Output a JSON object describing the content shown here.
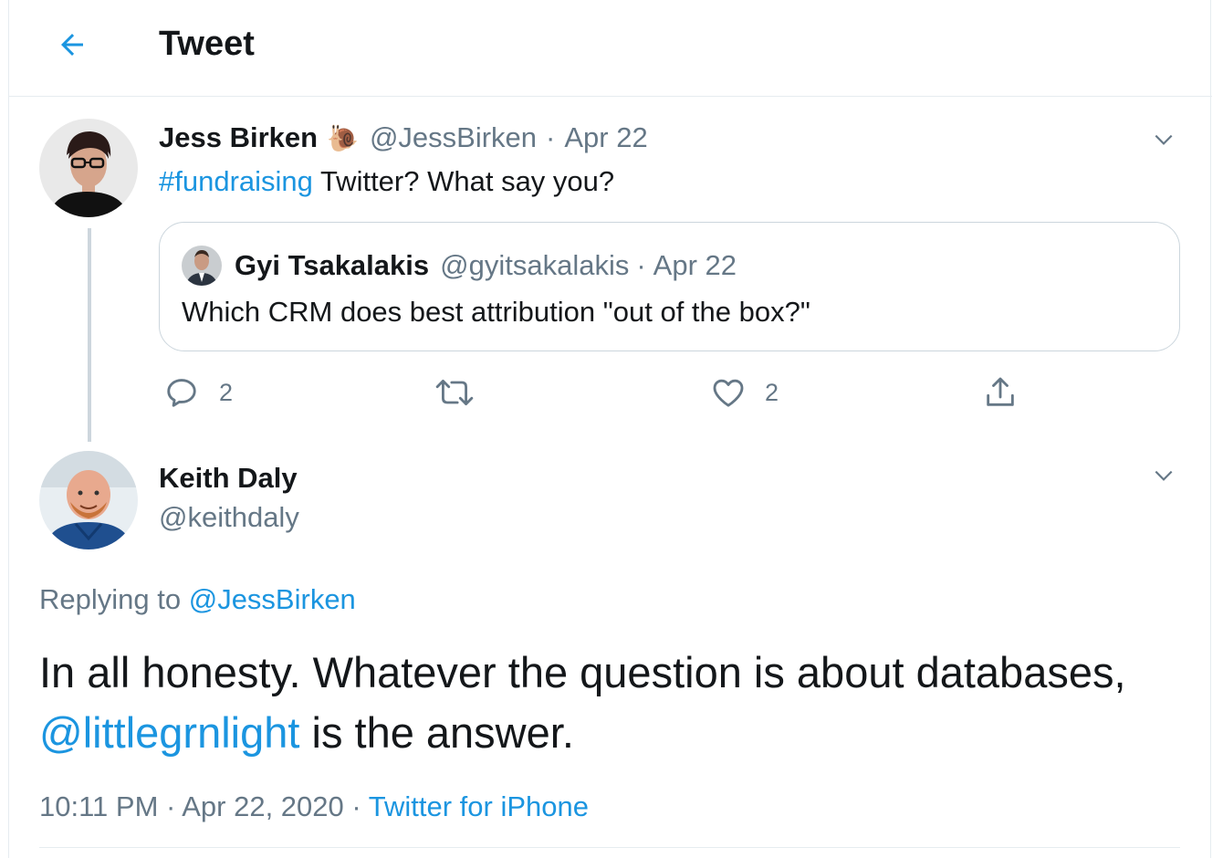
{
  "header": {
    "title": "Tweet",
    "back_icon": "arrow-left-icon"
  },
  "colors": {
    "accent": "#1b95e0",
    "text": "#14171a",
    "muted": "#657786",
    "border": "#e6ecf0"
  },
  "parent_tweet": {
    "author_name": "Jess Birken",
    "author_emoji": "🐌",
    "author_handle": "@JessBirken",
    "separator": "·",
    "date": "Apr 22",
    "hashtag": "#fundraising",
    "text": " Twitter? What say you?",
    "quoted": {
      "author_name": "Gyi Tsakalakis",
      "author_handle": "@gyitsakalakis",
      "separator": "·",
      "date": "Apr 22",
      "text": "Which CRM does best attribution \"out of the box?\""
    },
    "actions": {
      "reply_count": "2",
      "like_count": "2"
    }
  },
  "main_tweet": {
    "author_name": "Keith Daly",
    "author_handle": "@keithdaly",
    "replying_prefix": "Replying to ",
    "replying_to": "@JessBirken",
    "text_line1": "In all honesty. Whatever the question is about databases,",
    "mention": "@littlegrnlight",
    "text_line2": " is the answer.",
    "time": "10:11 PM",
    "dot1": " · ",
    "date": "Apr 22, 2020",
    "dot2": " · ",
    "source": "Twitter for iPhone"
  }
}
